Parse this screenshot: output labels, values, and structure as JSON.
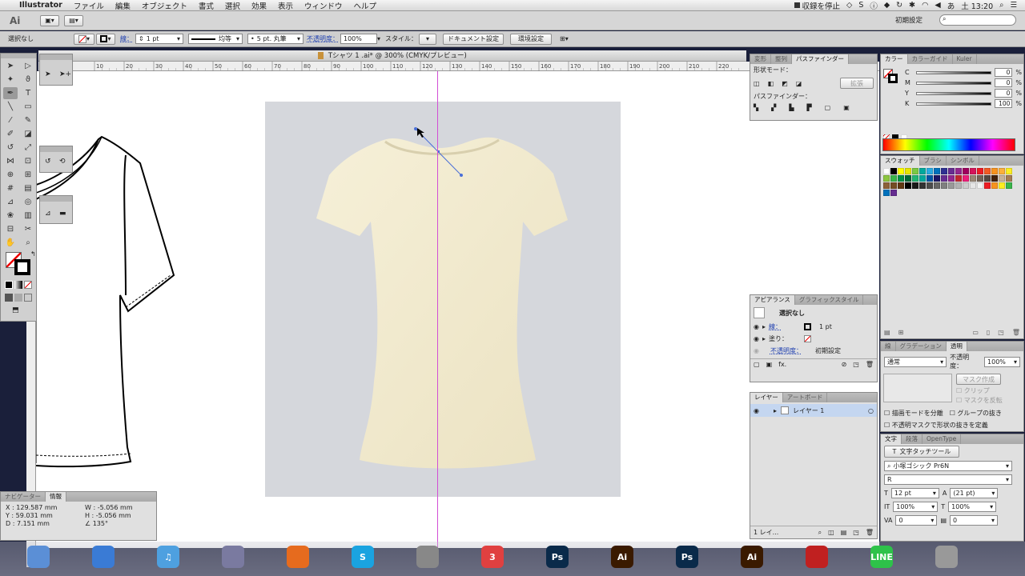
{
  "menubar": {
    "apple": "",
    "app_name": "Illustrator",
    "items": [
      "ファイル",
      "編集",
      "オブジェクト",
      "書式",
      "選択",
      "効果",
      "表示",
      "ウィンドウ",
      "ヘルプ"
    ],
    "recording_label": "収録を停止",
    "clock": "土 13:20"
  },
  "appbar": {
    "logo": "Ai",
    "workspace": "初期設定",
    "search_placeholder": ""
  },
  "controlbar": {
    "selection": "選択なし",
    "stroke_label": "線：",
    "stroke_weight": "1 pt",
    "profile": "均等",
    "brush": "5 pt. 丸筆",
    "opacity_label": "不透明度：",
    "opacity": "100%",
    "style_label": "スタイル：",
    "doc_setup": "ドキュメント設定",
    "prefs": "環境設定"
  },
  "document": {
    "tab_title": "Tシャツ 1 .ai* @ 300% (CMYK/プレビュー)",
    "ruler_ticks": [
      "10",
      "20",
      "30",
      "40",
      "50",
      "60",
      "70",
      "80",
      "90",
      "100",
      "110",
      "120",
      "130",
      "140",
      "150",
      "160",
      "170",
      "180",
      "190",
      "200",
      "210",
      "220"
    ]
  },
  "pathfinder": {
    "tabs": [
      "変形",
      "整列",
      "パスファインダー"
    ],
    "shape_modes_label": "形状モード：",
    "expand_label": "拡張",
    "pathfinders_label": "パスファインダー："
  },
  "color": {
    "tabs": [
      "カラー",
      "カラーガイド",
      "Kuler"
    ],
    "channels": [
      {
        "name": "C",
        "value": "0"
      },
      {
        "name": "M",
        "value": "0"
      },
      {
        "name": "Y",
        "value": "0"
      },
      {
        "name": "K",
        "value": "100"
      }
    ],
    "unit": "%"
  },
  "swatches": {
    "tabs": [
      "スウォッチ",
      "ブラシ",
      "シンボル"
    ],
    "colors": [
      "#ffffff",
      "#000000",
      "#ffff00",
      "#e6e600",
      "#7ac943",
      "#00a99d",
      "#29abe2",
      "#0071bc",
      "#2e3192",
      "#662d91",
      "#93278f",
      "#9e005d",
      "#d4145a",
      "#ed1c24",
      "#f15a24",
      "#f7931e",
      "#fbb03b",
      "#fcee21",
      "#8cc63f",
      "#39b54a",
      "#009245",
      "#006837",
      "#22b573",
      "#00a99d",
      "#0054a6",
      "#1b1464",
      "#662d91",
      "#92278f",
      "#c1272d",
      "#ed1e79",
      "#998675",
      "#736357",
      "#534741",
      "#42210b",
      "#c7b299",
      "#a67c52",
      "#8c6239",
      "#754c24",
      "#603813",
      "#000000",
      "#1a1a1a",
      "#333333",
      "#4d4d4d",
      "#666666",
      "#808080",
      "#999999",
      "#b3b3b3",
      "#cccccc",
      "#e6e6e6",
      "#f2f2f2",
      "#ed1c24",
      "#f7931e",
      "#fcee21",
      "#39b54a",
      "#0071bc",
      "#662d91"
    ]
  },
  "appearance": {
    "tabs": [
      "アピアランス",
      "グラフィックスタイル"
    ],
    "title": "選択なし",
    "stroke_label": "線：",
    "stroke_value": "1 pt",
    "fill_label": "塗り：",
    "opacity_label": "不透明度：",
    "opacity_value": "初期設定",
    "fx": "fx."
  },
  "transparency": {
    "tabs": [
      "線",
      "グラデーション",
      "透明"
    ],
    "mode": "通常",
    "opacity_label": "不透明度：",
    "opacity": "100%",
    "mask_button": "マスク作成",
    "clip": "クリップ",
    "invert": "マスクを反転",
    "isolate": "描画モードを分離",
    "knockout": "グループの抜き",
    "opacity_mask": "不透明マスクで形状の抜きを定義"
  },
  "layers": {
    "tabs": [
      "レイヤー",
      "アートボード"
    ],
    "layer_name": "レイヤー 1",
    "footer": "1 レイ..."
  },
  "character": {
    "tabs": [
      "文字",
      "段落",
      "OpenType"
    ],
    "tool_label": "文字タッチツール",
    "font": "小塚ゴシック Pr6N",
    "style": "R",
    "size": "12 pt",
    "leading": "(21 pt)",
    "vscale": "100%",
    "hscale": "100%",
    "kerning": "0",
    "tracking": "0"
  },
  "info": {
    "tabs": [
      "ナビゲーター",
      "情報"
    ],
    "x": "X : 129.587 mm",
    "y": "Y : 59.031 mm",
    "w": "W : -5.056 mm",
    "h": "H : -5.056 mm",
    "d": "D : 7.151 mm",
    "angle": "135°"
  },
  "dock": {
    "apps": [
      {
        "name": "Finder",
        "label": "",
        "color": "#5b8fd6"
      },
      {
        "name": "Safari",
        "label": "",
        "color": "#3a7bd5"
      },
      {
        "name": "iTunes",
        "label": "♫",
        "color": "#4ea0e0"
      },
      {
        "name": "Mail",
        "label": "",
        "color": "#7a7aa0"
      },
      {
        "name": "Firefox",
        "label": "",
        "color": "#e66b1e"
      },
      {
        "name": "Skype",
        "label": "S",
        "color": "#1aa3e0"
      },
      {
        "name": "Home",
        "label": "",
        "color": "#888"
      },
      {
        "name": "Calendar",
        "label": "3",
        "color": "#e04040"
      },
      {
        "name": "Photoshop",
        "label": "Ps",
        "color": "#0a2a4a"
      },
      {
        "name": "Illustrator",
        "label": "Ai",
        "color": "#3a1a00"
      },
      {
        "name": "Photoshop2",
        "label": "Ps",
        "color": "#0a2a4a"
      },
      {
        "name": "Illustrator2",
        "label": "Ai",
        "color": "#3a1a00"
      },
      {
        "name": "Acrobat",
        "label": "",
        "color": "#c02020"
      },
      {
        "name": "Line",
        "label": "LINE",
        "color": "#2ec24a"
      },
      {
        "name": "Trash",
        "label": "",
        "color": "#999"
      }
    ]
  }
}
